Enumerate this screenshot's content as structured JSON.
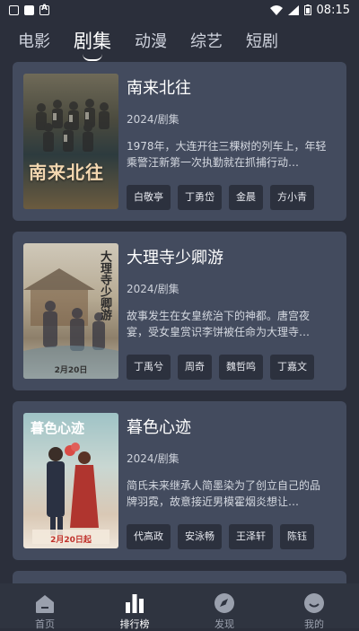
{
  "status": {
    "time": "08:15"
  },
  "tabs": [
    {
      "label": "电影"
    },
    {
      "label": "剧集"
    },
    {
      "label": "动漫"
    },
    {
      "label": "综艺"
    },
    {
      "label": "短剧"
    }
  ],
  "active_tab": "剧集",
  "items": [
    {
      "title": "南来北往",
      "poster_text": "南来北往",
      "meta": "2024/剧集",
      "desc": "1978年，大连开往三棵树的列车上，年轻乘警汪新第一次执勤就在抓捕行动…",
      "tags": [
        "白敬亭",
        "丁勇岱",
        "金晨",
        "方小青"
      ]
    },
    {
      "title": "大理寺少卿游",
      "poster_text": "大理寺少卿游",
      "poster_date": "2月20日",
      "meta": "2024/剧集",
      "desc": "故事发生在女皇统治下的神都。唐宫夜宴，受女皇赏识李饼被任命为大理寺…",
      "tags": [
        "丁禹兮",
        "周奇",
        "魏哲鸣",
        "丁嘉文"
      ]
    },
    {
      "title": "暮色心迹",
      "poster_text": "暮色心迹",
      "poster_date": "2月20日起",
      "meta": "2024/剧集",
      "desc": "简氏未来继承人简墨染为了创立自己的品牌羽霓，故意接近男模霍烟炎想让…",
      "tags": [
        "代高政",
        "安泳畅",
        "王泽轩",
        "陈钰"
      ]
    }
  ],
  "nav": [
    {
      "label": "首页",
      "icon": "home-icon"
    },
    {
      "label": "排行榜",
      "icon": "chart-icon"
    },
    {
      "label": "发现",
      "icon": "compass-icon"
    },
    {
      "label": "我的",
      "icon": "smiley-icon"
    }
  ],
  "colors": {
    "background": "#2b2f3b",
    "card": "#434b5e",
    "tag": "#2c313e"
  }
}
